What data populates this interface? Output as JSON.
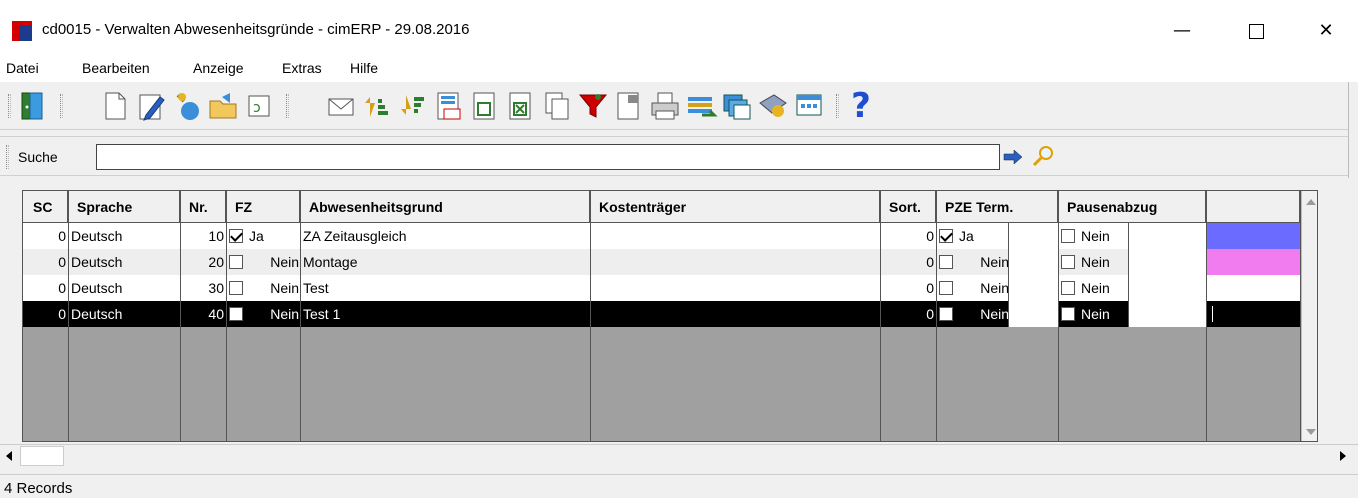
{
  "window": {
    "title": "cd0015 - Verwalten Abwesenheitsgründe - cimERP - 29.08.2016",
    "minimize": "—",
    "close": "✕"
  },
  "menu": [
    "Datei",
    "Bearbeiten",
    "Anzeige",
    "Extras",
    "Hilfe"
  ],
  "toolbar": {
    "icons": [
      "exit-icon",
      "new-document-icon",
      "edit-icon",
      "copy-record-icon",
      "open-folder-icon",
      "refresh-icon",
      "mail-icon",
      "sort-ascending-icon",
      "sort-descending-icon",
      "calculator-icon",
      "export-icon",
      "excel-export-icon",
      "copy-icon",
      "filter-icon",
      "properties-icon",
      "print-icon",
      "transfer-icon",
      "windows-icon",
      "book-icon",
      "table-view-icon",
      "help-icon"
    ],
    "help_glyph": "?"
  },
  "search": {
    "label": "Suche",
    "value": ""
  },
  "grid": {
    "headers": [
      "SC",
      "Sprache",
      "Nr.",
      "FZ",
      "Abwesenheitsgrund",
      "Kostenträger",
      "Sort.",
      "PZE Term.",
      "Pausenabzug",
      ""
    ],
    "rows": [
      {
        "sc": "0",
        "sprache": "Deutsch",
        "nr": "10",
        "fz_checked": true,
        "fz": "Ja",
        "grund": "ZA Zeitausgleich",
        "kostentraeger": "",
        "sort": "0",
        "pze_checked": true,
        "pze": "Ja",
        "pause_checked": false,
        "pause": "Nein",
        "color": "#6b6bff"
      },
      {
        "sc": "0",
        "sprache": "Deutsch",
        "nr": "20",
        "fz_checked": false,
        "fz": "Nein",
        "grund": "Montage",
        "kostentraeger": "",
        "sort": "0",
        "pze_checked": false,
        "pze": "Nein",
        "pause_checked": false,
        "pause": "Nein",
        "color": "#f07cf0"
      },
      {
        "sc": "0",
        "sprache": "Deutsch",
        "nr": "30",
        "fz_checked": false,
        "fz": "Nein",
        "grund": "Test",
        "kostentraeger": "",
        "sort": "0",
        "pze_checked": false,
        "pze": "Nein",
        "pause_checked": false,
        "pause": "Nein",
        "color": "#ffffff"
      },
      {
        "sc": "0",
        "sprache": "Deutsch",
        "nr": "40",
        "fz_checked": false,
        "fz": "Nein",
        "grund": "Test 1",
        "kostentraeger": "",
        "sort": "0",
        "pze_checked": false,
        "pze": "Nein",
        "pause_checked": false,
        "pause": "Nein",
        "color": "#000000",
        "selected": true
      }
    ]
  },
  "status": {
    "records": "4 Records"
  }
}
